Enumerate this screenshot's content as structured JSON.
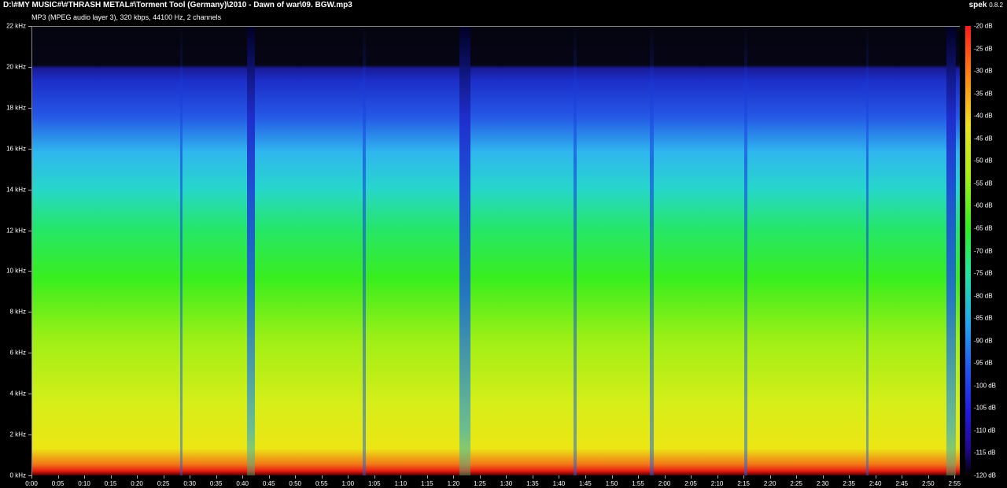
{
  "window": {
    "title": "D:\\#MY MUSIC#\\#THRASH METAL#\\Torment Tool (Germany)\\2010 - Dawn of war\\09. BGW.mp3",
    "info": "MP3 (MPEG audio layer 3), 320 kbps, 44100 Hz, 2 channels",
    "brand": "spek",
    "version": "0.8.2"
  },
  "freq_axis": [
    "22 kHz",
    "20 kHz",
    "18 kHz",
    "16 kHz",
    "14 kHz",
    "12 kHz",
    "10 kHz",
    "8 kHz",
    "6 kHz",
    "4 kHz",
    "2 kHz",
    "0 kHz"
  ],
  "time_axis": [
    "0:00",
    "0:05",
    "0:10",
    "0:15",
    "0:20",
    "0:25",
    "0:30",
    "0:35",
    "0:40",
    "0:45",
    "0:50",
    "0:55",
    "1:00",
    "1:05",
    "1:10",
    "1:15",
    "1:20",
    "1:25",
    "1:30",
    "1:35",
    "1:40",
    "1:45",
    "1:50",
    "1:55",
    "2:00",
    "2:05",
    "2:10",
    "2:15",
    "2:20",
    "2:25",
    "2:30",
    "2:35",
    "2:40",
    "2:45",
    "2:50",
    "2:55"
  ],
  "db_scale": [
    "-20 dB",
    "-25 dB",
    "-30 dB",
    "-35 dB",
    "-40 dB",
    "-45 dB",
    "-50 dB",
    "-55 dB",
    "-60 dB",
    "-65 dB",
    "-70 dB",
    "-75 dB",
    "-80 dB",
    "-85 dB",
    "-90 dB",
    "-95 dB",
    "-100 dB",
    "-105 dB",
    "-110 dB",
    "-115 dB",
    "-120 dB"
  ],
  "spectrogram": {
    "duration_seconds": 176,
    "max_freq_khz": 22,
    "cutoff_khz": 20,
    "colors": {
      "background": "#000000",
      "high": "#ff1a1a",
      "mid": "#38ee1e",
      "low": "#2018e0"
    }
  }
}
